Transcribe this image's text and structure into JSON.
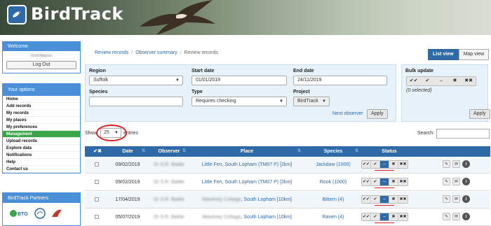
{
  "app": {
    "title": "BirdTrack"
  },
  "sidebar": {
    "welcome_title": "Welcome",
    "username": "Scott Mapson",
    "logout_label": "Log Out",
    "options_title": "Your options",
    "items": [
      {
        "label": "Home"
      },
      {
        "label": "Add records"
      },
      {
        "label": "My records"
      },
      {
        "label": "My places"
      },
      {
        "label": "My preferences"
      },
      {
        "label": "Management"
      },
      {
        "label": "Upload records"
      },
      {
        "label": "Explore data"
      },
      {
        "label": "Notifications"
      },
      {
        "label": "Help"
      },
      {
        "label": "Contact us"
      }
    ],
    "partners_title": "BirdTrack Partners",
    "partner_bto": "BTO"
  },
  "breadcrumb": {
    "item1": "Review records",
    "item2": "Observer summary",
    "current": "Review records",
    "sep": "/"
  },
  "view_toggle": {
    "list": "List view",
    "map": "Map view"
  },
  "filters": {
    "region_label": "Region",
    "region_value": "Suffolk",
    "start_label": "Start date",
    "start_value": "01/01/2019",
    "end_label": "End date",
    "end_value": "24/11/2019",
    "species_label": "Species",
    "species_value": "",
    "type_label": "Type",
    "type_value": "Requires checking",
    "project_label": "Project",
    "project_value": "BirdTrack",
    "next_observer": "Next observer",
    "apply": "Apply"
  },
  "bulk": {
    "title": "Bulk update",
    "selected": "(0 selected)",
    "apply": "Apply",
    "btns": [
      "✔✔",
      "✔",
      "–",
      "✖",
      "✖✖"
    ]
  },
  "table_controls": {
    "show": "Show",
    "page_size": "25",
    "entries": "entries",
    "search_label": "Search:"
  },
  "table": {
    "headers": {
      "check": "✔✖",
      "date": "Date",
      "observer": "Observer",
      "place": "Place",
      "species": "Species",
      "status": "Status"
    },
    "rows": [
      {
        "date": "09/02/2019",
        "observer": "Dr S.R. Baillie",
        "place": "Little Fen, South Lopham (TM07 P) [2km]",
        "species": "Jackdaw (1000)"
      },
      {
        "date": "09/02/2019",
        "observer": "Dr S.R. Baillie",
        "place": "Little Fen, South Lopham (TM07 P) [2km]",
        "species": "Rook (1000)"
      },
      {
        "date": "17/04/2019",
        "observer": "Dr S.R. Baillie",
        "place_blur": "Waveney Cottage",
        "place": ", South Lopham [10km]",
        "species": "Bittern (4)"
      },
      {
        "date": "05/07/2019",
        "observer": "Dr S.R. Baillie",
        "place_blur": "Waveney Cottage",
        "place": ", South Lopham [10km]",
        "species": "Raven (4)"
      }
    ],
    "status_icons": [
      "✔✔",
      "✔",
      "–",
      "✖",
      "✖✖"
    ],
    "action_icons": [
      "✎",
      "✉",
      "i"
    ]
  },
  "colors": {
    "brand": "#2e6aa8",
    "panel": "#4a90d9",
    "active": "#3aa648",
    "highlight": "#e02020"
  }
}
